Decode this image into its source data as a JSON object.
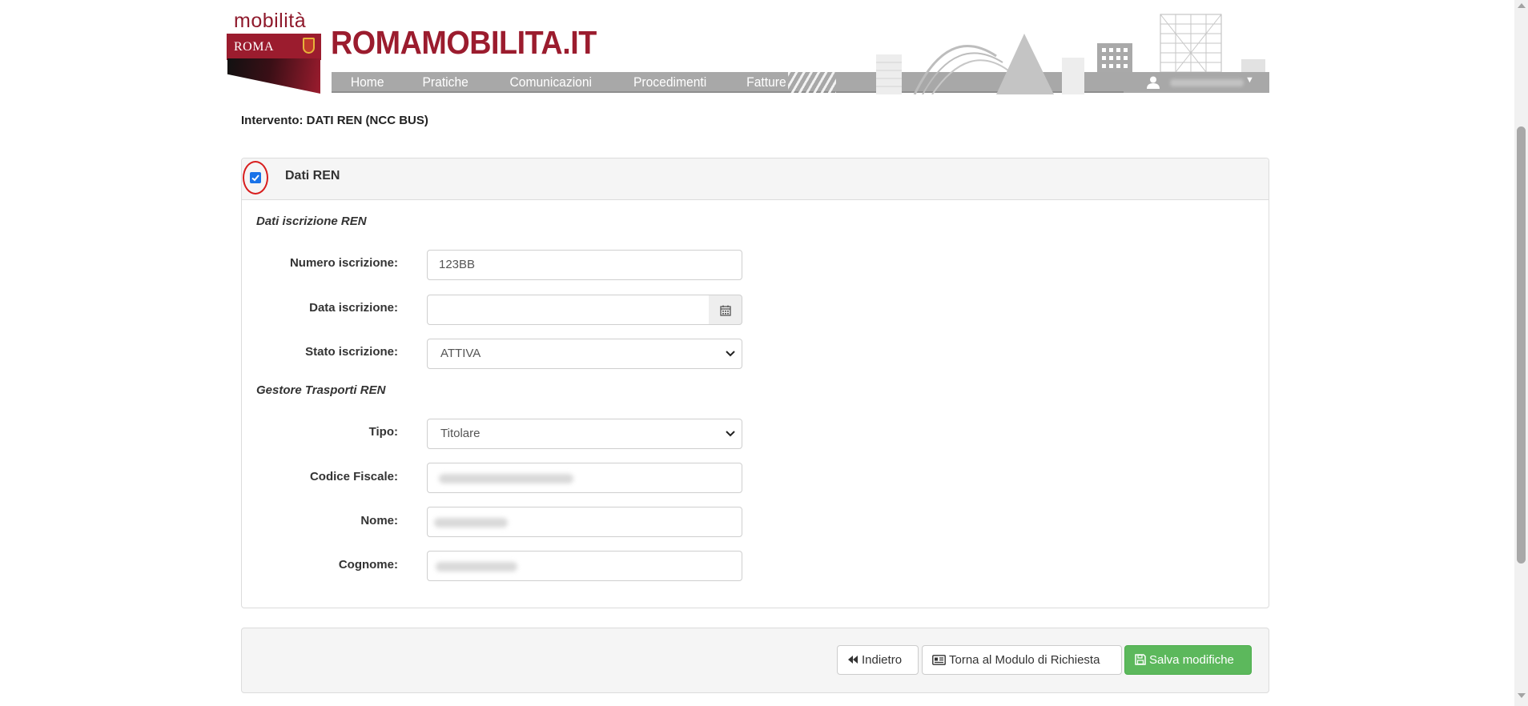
{
  "header": {
    "logo_top": "mobilità",
    "logo_city": "ROMA",
    "brand_title": "ROMAMOBILITA.IT",
    "nav": [
      {
        "label": "Home"
      },
      {
        "label": "Pratiche"
      },
      {
        "label": "Comunicazioni"
      },
      {
        "label": "Procedimenti"
      },
      {
        "label": "Fatture"
      }
    ],
    "user_icon": "user-icon",
    "user_caret_icon": "caret-down-icon"
  },
  "page": {
    "intervention_label": "Intervento: DATI REN (NCC BUS)"
  },
  "panel": {
    "checkbox_checked": true,
    "title": "Dati REN",
    "section_iscrizione": "Dati iscrizione REN",
    "section_gestore": "Gestore Trasporti REN",
    "fields": {
      "numero_label": "Numero iscrizione:",
      "numero_value": "123BB",
      "data_label": "Data iscrizione:",
      "data_value": "",
      "stato_label": "Stato iscrizione:",
      "stato_value": "ATTIVA",
      "tipo_label": "Tipo:",
      "tipo_value": "Titolare",
      "cf_label": "Codice Fiscale:",
      "nome_label": "Nome:",
      "cognome_label": "Cognome:"
    }
  },
  "toolbar": {
    "back_label": "Indietro",
    "form_label": "Torna al Modulo di Richiesta",
    "save_label": "Salva modifiche"
  },
  "colors": {
    "brand": "#9b1c2e",
    "nav_bg": "#a8a8a8",
    "save_green": "#5cb85c",
    "checkbox_blue": "#1a73e8",
    "highlight_red": "#d81e1e"
  }
}
